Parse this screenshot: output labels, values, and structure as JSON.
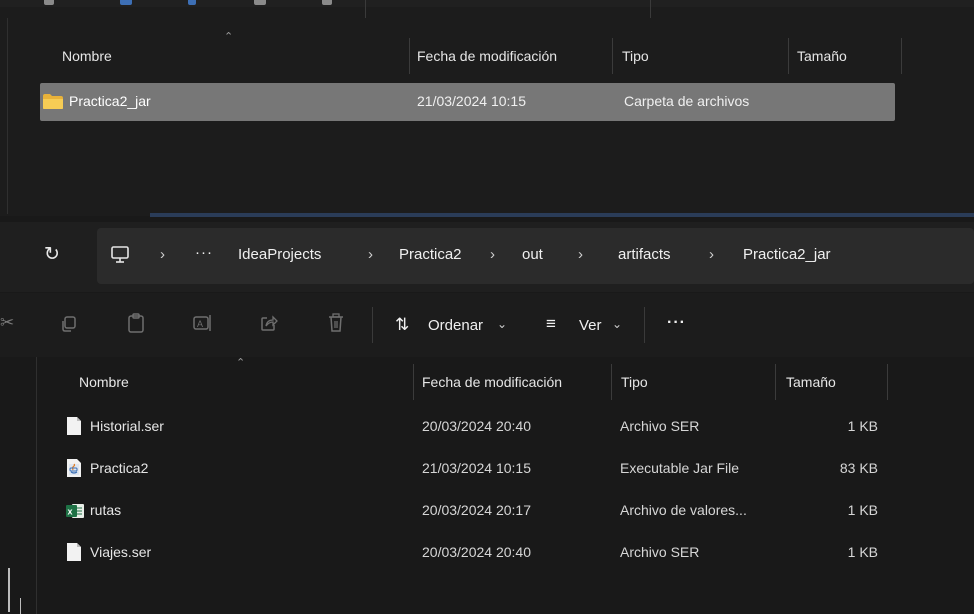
{
  "top_window": {
    "columns": [
      "Nombre",
      "Fecha de modificación",
      "Tipo",
      "Tamaño"
    ],
    "rows": [
      {
        "name": "Practica2_jar",
        "date": "21/03/2024 10:15",
        "type": "Carpeta de archivos",
        "size": "",
        "icon": "folder-icon",
        "selected": true
      }
    ]
  },
  "address_bar": {
    "breadcrumbs": [
      "IdeaProjects",
      "Practica2",
      "out",
      "artifacts",
      "Practica2_jar"
    ],
    "overflow": "···"
  },
  "command_bar": {
    "sort_label": "Ordenar",
    "view_label": "Ver",
    "more_label": "···"
  },
  "file_list": {
    "columns": [
      "Nombre",
      "Fecha de modificación",
      "Tipo",
      "Tamaño"
    ],
    "rows": [
      {
        "name": "Historial.ser",
        "date": "20/03/2024 20:40",
        "type": "Archivo SER",
        "size": "1 KB",
        "icon": "file-icon"
      },
      {
        "name": "Practica2",
        "date": "21/03/2024 10:15",
        "type": "Executable Jar File",
        "size": "83 KB",
        "icon": "java-jar-icon"
      },
      {
        "name": "rutas",
        "date": "20/03/2024 20:17",
        "type": "Archivo de valores...",
        "size": "1 KB",
        "icon": "excel-csv-icon"
      },
      {
        "name": "Viajes.ser",
        "date": "20/03/2024 20:40",
        "type": "Archivo SER",
        "size": "1 KB",
        "icon": "file-icon"
      }
    ]
  },
  "colors": {
    "background": "#191919",
    "selected_row": "#777777",
    "folder_yellow": "#f2c14e",
    "excel_green": "#1e7145"
  }
}
